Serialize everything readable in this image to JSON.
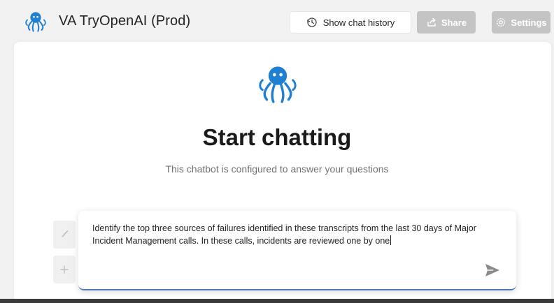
{
  "header": {
    "app_title": "VA TryOpenAI (Prod)",
    "history_button_label": "Show chat history",
    "share_button_label": "Share",
    "settings_button_label": "Settings"
  },
  "chat": {
    "heading": "Start chatting",
    "subheading": "This chatbot is configured to answer your questions"
  },
  "composer": {
    "input_value": "Identify the top three sources of failures identified in these transcripts from the last 30 days of Major Incident Management calls. In these calls, incidents are reviewed one by one"
  },
  "icons": {
    "logo": "octopus-logo-icon",
    "history": "clock-history-icon",
    "share": "share-icon",
    "settings": "gear-icon",
    "send": "send-icon",
    "broom": "broom-icon",
    "add": "plus-icon"
  },
  "colors": {
    "accent": "#4a78c2",
    "logo_blue": "#1f7fd1",
    "disabled_button": "#c4c4c4"
  }
}
